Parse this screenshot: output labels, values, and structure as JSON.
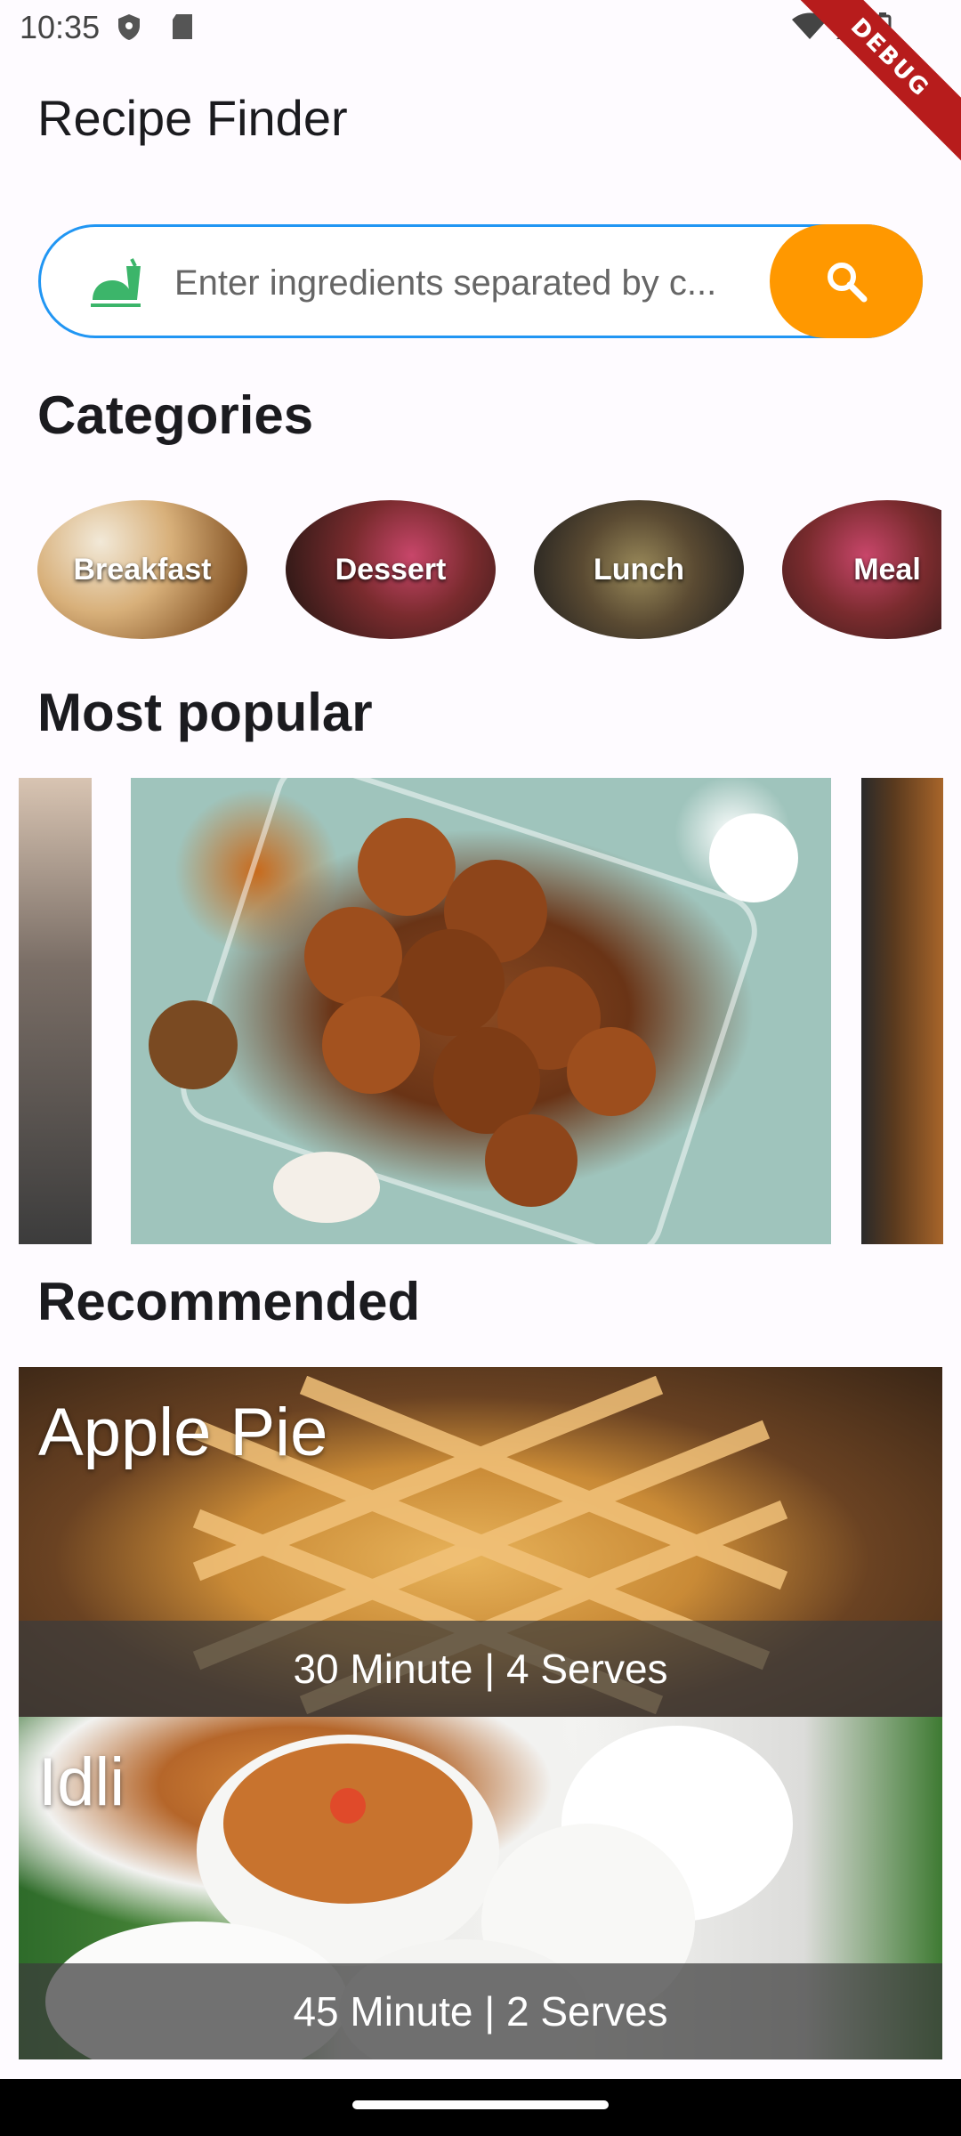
{
  "status_bar": {
    "time": "10:35",
    "icons": [
      "shield-icon",
      "sd-card-icon",
      "wifi-icon",
      "signal-icon",
      "battery-icon"
    ]
  },
  "debug_banner": "DEBUG",
  "app": {
    "title": "Recipe Finder"
  },
  "search": {
    "placeholder": "Enter ingredients separated by c...",
    "leading_icon": "fast-food-icon",
    "button_icon": "search-icon",
    "accent_border": "#2196f3",
    "button_color": "#ff9800"
  },
  "sections": {
    "categories": "Categories",
    "most_popular": "Most popular",
    "recommended": "Recommended"
  },
  "categories": [
    {
      "label": "Breakfast"
    },
    {
      "label": "Dessert"
    },
    {
      "label": "Lunch"
    },
    {
      "label": "Meal"
    }
  ],
  "most_popular": [
    {
      "image": "food-photo"
    },
    {
      "image": "cinnamon-rolls-photo"
    },
    {
      "image": "mushrooms-photo"
    }
  ],
  "recommended": [
    {
      "name": "Apple Pie",
      "meta": "30 Minute | 4 Serves"
    },
    {
      "name": "Idli",
      "meta": "45 Minute | 2 Serves"
    }
  ]
}
